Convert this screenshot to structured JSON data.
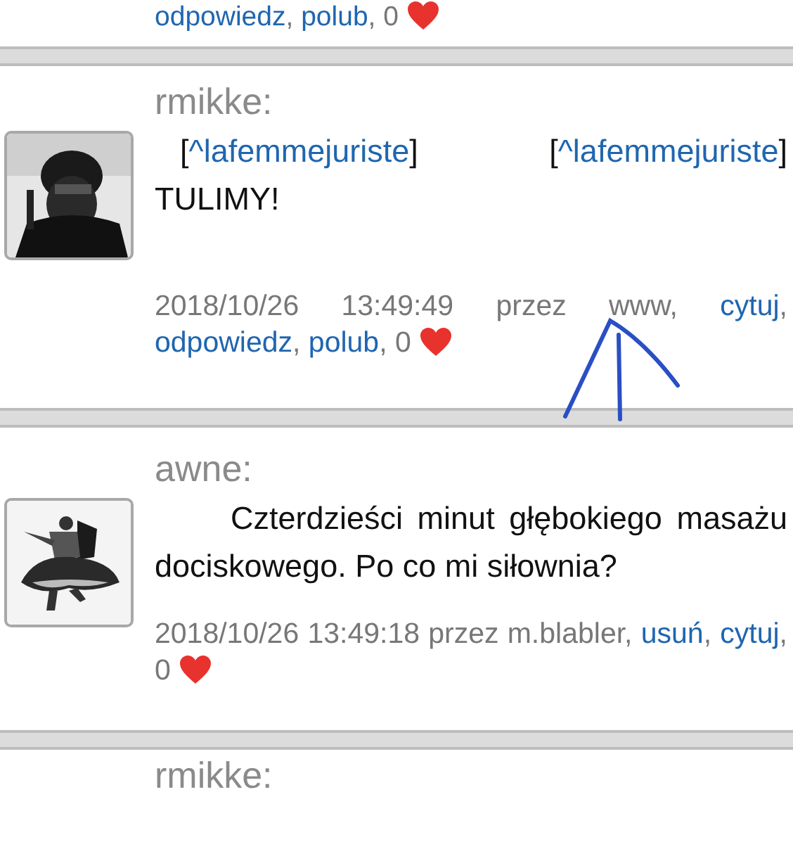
{
  "top_fragment": {
    "meta": [
      {
        "kind": "link",
        "text": "odpowiedz"
      },
      {
        "kind": "text",
        "text": ", "
      },
      {
        "kind": "link",
        "text": "polub"
      },
      {
        "kind": "text",
        "text": ", 0 "
      },
      {
        "kind": "heart"
      }
    ]
  },
  "posts": [
    {
      "author": "rmikke:",
      "body": [
        {
          "kind": "text",
          "text": "["
        },
        {
          "kind": "link",
          "text": "^lafemmejuriste"
        },
        {
          "kind": "text",
          "text": "] ["
        },
        {
          "kind": "link",
          "text": "^lafemmejuriste"
        },
        {
          "kind": "text",
          "text": "] TULIMY!"
        }
      ],
      "meta": [
        {
          "kind": "text",
          "text": "2018/10/26 13:49:49 przez www, "
        },
        {
          "kind": "link",
          "text": "cytuj"
        },
        {
          "kind": "text",
          "text": ", "
        },
        {
          "kind": "link",
          "text": "odpowiedz"
        },
        {
          "kind": "text",
          "text": ", "
        },
        {
          "kind": "link",
          "text": "polub"
        },
        {
          "kind": "text",
          "text": ", 0 "
        },
        {
          "kind": "heart"
        }
      ]
    },
    {
      "author": "awne:",
      "body": [
        {
          "kind": "text",
          "text": "Czterdzieści minut głębokiego masażu dociskowego. Po co mi siłownia?"
        }
      ],
      "meta": [
        {
          "kind": "text",
          "text": "2018/10/26 13:49:18 przez m.blabler, "
        },
        {
          "kind": "link",
          "text": "usuń"
        },
        {
          "kind": "text",
          "text": ", "
        },
        {
          "kind": "link",
          "text": "cytuj"
        },
        {
          "kind": "text",
          "text": ", 0 "
        },
        {
          "kind": "heart"
        }
      ]
    }
  ],
  "bottom_fragment": {
    "author": "rmikke:"
  }
}
